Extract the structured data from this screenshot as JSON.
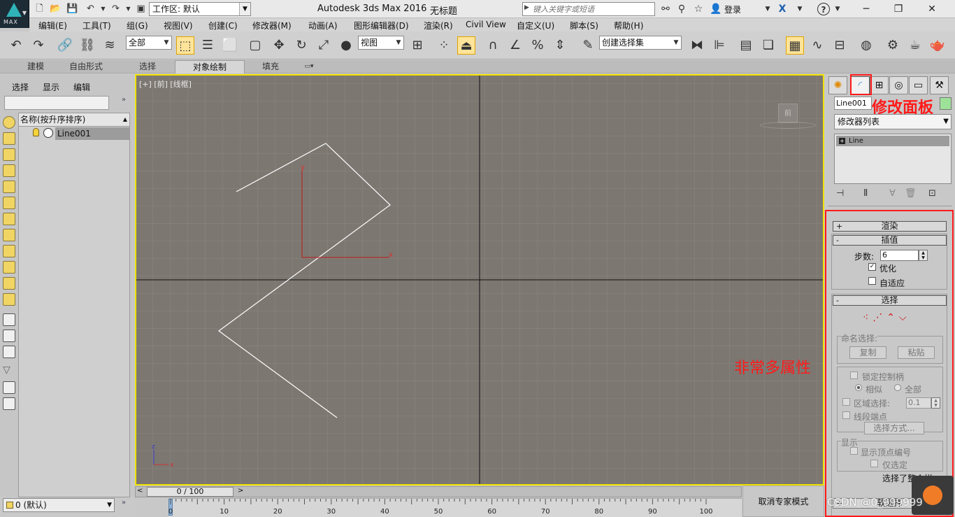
{
  "titlebar": {
    "logo": "MAX",
    "workspace": "工作区: 默认",
    "app_title": "Autodesk 3ds Max 2016",
    "doc_title": "无标题",
    "search_placeholder": "键入关键字或短语",
    "login": "登录"
  },
  "menu": [
    "编辑(E)",
    "工具(T)",
    "组(G)",
    "视图(V)",
    "创建(C)",
    "修改器(M)",
    "动画(A)",
    "图形编辑器(D)",
    "渲染(R)",
    "Civil View",
    "自定义(U)",
    "脚本(S)",
    "帮助(H)"
  ],
  "toolbar": {
    "filter": "全部",
    "ref_coord": "视图",
    "selection_set": "创建选择集"
  },
  "ribbon": {
    "tabs": [
      "建模",
      "自由形式",
      "选择",
      "对象绘制",
      "填充"
    ],
    "active": "对象绘制"
  },
  "scene_explorer": {
    "tabs": [
      "选择",
      "显示",
      "编辑"
    ],
    "header": "名称(按升序排序)",
    "objects": [
      "Line001"
    ],
    "layer": "0 (默认)"
  },
  "viewport": {
    "label": "[+] [前] [线框]",
    "viewcube_face": "前",
    "axes": {
      "x": "x",
      "y": "y",
      "z": "z"
    }
  },
  "command_panel": {
    "object_name": "Line001",
    "object_color": "#9ee29a",
    "modifier_list": "修改器列表",
    "stack_item": "Line",
    "annotation_modify": "修改面板",
    "annotation_props": "非常多属性",
    "rollouts": {
      "render": "渲染",
      "interpolation": "插值",
      "steps_label": "步数:",
      "steps_value": "6",
      "optimize": "优化",
      "adaptive": "自适应",
      "selection": "选择",
      "named_sel": "命名选择:",
      "copy": "复制",
      "paste": "粘贴",
      "lock_handles": "锁定控制柄",
      "alike": "相似",
      "all": "全部",
      "area_sel": "区域选择:",
      "area_value": "0.1",
      "segment_end": "线段端点",
      "select_by": "选择方式...",
      "display": "显示",
      "show_vertex_numbers": "显示顶点编号",
      "selected_only": "仅选定",
      "selected_status": "选择了整个样",
      "soft_selection": "软选择"
    }
  },
  "timeline": {
    "frame": "0 / 100",
    "ticks": [
      "0",
      "10",
      "20",
      "30",
      "40",
      "50",
      "60",
      "70",
      "80",
      "90",
      "100"
    ]
  },
  "expert_mode": "取消专家模式",
  "watermark": "CSDN @0_999999"
}
